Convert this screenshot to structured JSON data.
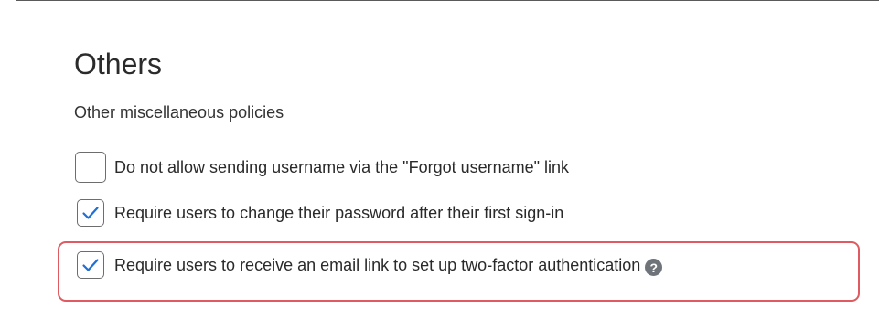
{
  "section": {
    "title": "Others",
    "subtitle": "Other miscellaneous policies"
  },
  "options": [
    {
      "label": "Do not allow sending username via the \"Forgot username\" link",
      "checked": false
    },
    {
      "label": "Require users to change their password after their first sign-in",
      "checked": true
    },
    {
      "label": "Require users to receive an email link to set up two-factor authentication",
      "checked": true,
      "highlighted": true
    }
  ],
  "help_icon_glyph": "?",
  "colors": {
    "checkmark": "#1f6fd6",
    "highlight_border": "#e05a62",
    "help_icon_bg": "#6e7479"
  }
}
